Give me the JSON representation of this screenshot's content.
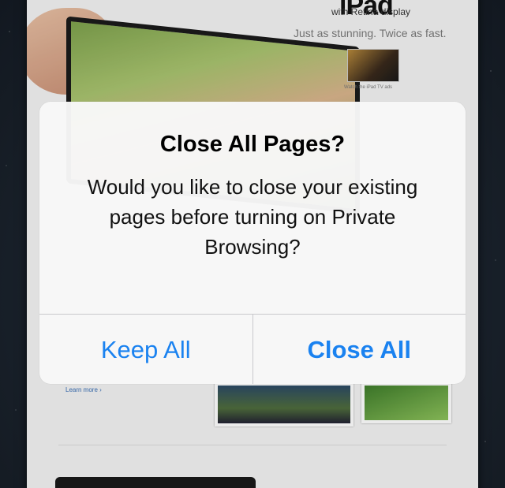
{
  "background_page": {
    "product_title": "iPad",
    "product_subtitle": "with Retina display",
    "tagline": "Just as stunning. Twice as fast.",
    "video_caption": "Watch the iPad TV ads",
    "learn_more_link": "Learn more ›"
  },
  "alert": {
    "title": "Close All Pages?",
    "message": "Would you like to close your existing pages before turning on Private Browsing?",
    "buttons": {
      "keep_all": "Keep All",
      "close_all": "Close All"
    },
    "accent_color": "#1a82f0"
  }
}
